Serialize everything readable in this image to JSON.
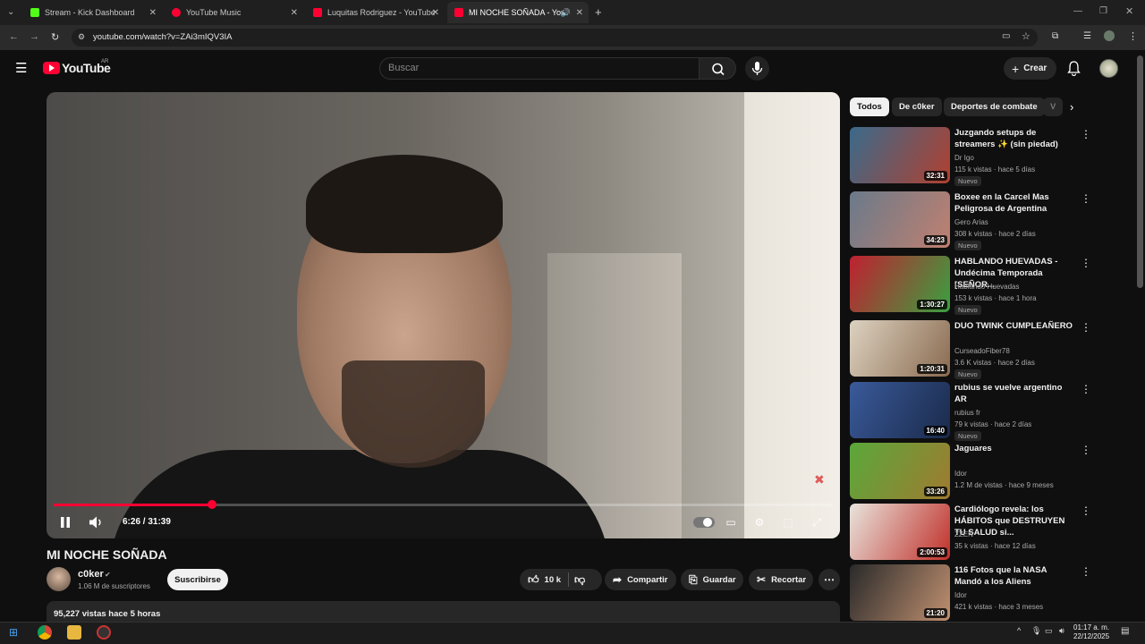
{
  "browser": {
    "tabs": [
      {
        "label": "Stream - Kick Dashboard",
        "color": "#53fc18"
      },
      {
        "label": "YouTube Music",
        "color": "#ff0033"
      },
      {
        "label": "Luquitas Rodriguez - YouTube",
        "color": "#ff0033"
      },
      {
        "label": "MI NOCHE SOÑADA - You",
        "color": "#ff0033"
      }
    ],
    "url": "youtube.com/watch?v=ZAi3mIQV3IA"
  },
  "header": {
    "logo": "YouTube",
    "region": "AR",
    "search_placeholder": "Buscar",
    "create_label": "Crear"
  },
  "player": {
    "time_current": "6:26",
    "time_total": "31:39",
    "time_display": "6:26 / 31:39",
    "progress_fraction": 0.203
  },
  "video": {
    "title": "MI NOCHE SOÑADA",
    "channel": "c0ker",
    "subscribers": "1.06 M de suscriptores",
    "subscribe_label": "Suscribirse",
    "likes": "10 k",
    "share_label": "Compartir",
    "save_label": "Guardar",
    "clip_label": "Recortar",
    "views_date": "95,227 vistas  hace 5 horas"
  },
  "sidebar": {
    "chips": [
      "Todos",
      "De c0ker",
      "Deportes de combate",
      "V"
    ],
    "recs": [
      {
        "title": "Juzgando setups de streamers ✨ (sin piedad)",
        "channel": "Dr Igo",
        "meta": "115 k vistas · hace 5 días",
        "duration": "32:31",
        "badge": "Nuevo",
        "c1": "#3a6a8a",
        "c2": "#b04030"
      },
      {
        "title": "Boxee en la Carcel Mas Peligrosa de Argentina",
        "channel": "Gero Arias",
        "meta": "308 k vistas · hace 2 días",
        "duration": "34:23",
        "badge": "Nuevo",
        "c1": "#6a7a8a",
        "c2": "#c08070"
      },
      {
        "title": "HABLANDO HUEVADAS - Undécima Temporada [SEÑOR...",
        "channel": "Hablando Huevadas",
        "meta": "153 k vistas · hace 1 hora",
        "duration": "1:30:27",
        "badge": "Nuevo",
        "c1": "#c02030",
        "c2": "#3aa040"
      },
      {
        "title": "DUO TWINK CUMPLEAÑERO",
        "channel": "CurseadoFiber78",
        "meta": "3.6 K vistas · hace 2 días",
        "duration": "1:20:31",
        "badge": "Nuevo",
        "c1": "#dcd2c0",
        "c2": "#8a6a50"
      },
      {
        "title": "rubius se vuelve argentino AR",
        "channel": "rubius fr",
        "meta": "79 k vistas · hace 2 días",
        "duration": "16:40",
        "badge": "Nuevo",
        "c1": "#3a5a9a",
        "c2": "#1a2a4a"
      },
      {
        "title": "Jaguares",
        "channel": "Idor",
        "meta": "1.2 M de vistas · hace 9 meses",
        "duration": "33:26",
        "badge": "",
        "c1": "#5aa83a",
        "c2": "#a07a30"
      },
      {
        "title": "Cardiólogo revela: los HÁBITOS que DESTRUYEN TU SALUD si...",
        "channel": "ZZEN",
        "meta": "35 k vistas · hace 12 días",
        "duration": "2:00:53",
        "badge": "",
        "c1": "#e8e4dc",
        "c2": "#c0302a"
      },
      {
        "title": "116 Fotos que la NASA Mandó a los Aliens",
        "channel": "Idor",
        "meta": "421 k vistas · hace 3 meses",
        "duration": "21:20",
        "badge": "",
        "c1": "#2a2a2a",
        "c2": "#c09070"
      }
    ]
  },
  "taskbar": {
    "time": "01:17 a. m.",
    "date": "22/12/2025"
  }
}
